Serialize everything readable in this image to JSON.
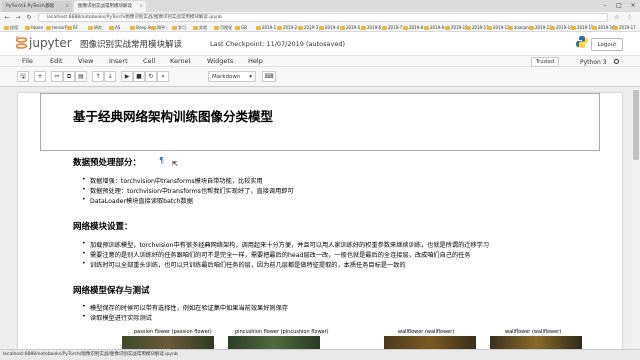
{
  "browser": {
    "tabs": [
      {
        "label": "PyTorch1-PyTorch基础"
      },
      {
        "label": "图像识别实战常用模块解读"
      }
    ],
    "url": "localhost:8888/notebooks/PyTorch/图像识别实战/图像识别实战常用模块解读.ipynb",
    "bookmarks": [
      "应用",
      "hbase",
      "tensorFl",
      "RF",
      "研究",
      "AS",
      "Deep lean",
      "知乎",
      "学习",
      "实验",
      "可视化",
      "GB",
      "2019-1",
      "2019-2",
      "2019-3",
      "2019-4",
      "2019-5",
      "2019-6",
      "2019-7",
      "2019-8",
      "2019-9",
      "2019-10",
      "2019-11",
      "2019-12",
      "anaconda",
      "2019-13",
      "2019-14",
      "2019-15",
      "2019-16",
      "2019-17"
    ]
  },
  "jupyter": {
    "logo_text": "jupyter",
    "notebook_name": "图像识别实战常用模块解读",
    "checkpoint": "Last Checkpoint: 11/07/2019 (autosaved)",
    "logout": "Logout",
    "menu": [
      "File",
      "Edit",
      "View",
      "Insert",
      "Cell",
      "Kernel",
      "Widgets",
      "Help"
    ],
    "trusted": "Trusted",
    "kernel": "Python 3",
    "celltype": "Markdown",
    "toolbar_icons": [
      "save-icon",
      "add-cell-icon",
      "cut-icon",
      "copy-icon",
      "paste-icon",
      "move-up-icon",
      "move-down-icon",
      "run-icon",
      "stop-icon",
      "restart-icon",
      "fast-forward-icon",
      "keyboard-icon"
    ]
  },
  "notebook": {
    "title": "基于经典网络架构训练图像分类模型",
    "pilcrow": "¶",
    "sections": [
      {
        "heading": "数据预处理部分：",
        "items": [
          "数据增强：torchvision中transforms模块自带功能，比较实用",
          "数据预处理：torchvision中transforms也帮我们实现好了，直接调用即可",
          "DataLoader模块直接读取batch数据"
        ]
      },
      {
        "heading": "网络模块设置：",
        "items": [
          "加载预训练模型，torchvision中有很多经典网络架构，调用起来十分方便，并且可以用人家训练好的权重参数来继续训练，也就是所谓的迁移学习",
          "需要注意的是别人训练好的任务跟咱们的可不是完全一样，需要把最后的head层改一改，一般也就是最后的全连接层，改成咱们自己的任务",
          "训练时可以全部重头训练，也可以只训练最后咱们任务的层，因为前几层都是做特征提取的，本质任务目标是一致的"
        ]
      },
      {
        "heading": "网络模型保存与测试",
        "items": [
          "模型保存的时候可以带有选择性，例如在验证集中如果当前效果好则保存",
          "读取模型进行实际测试"
        ]
      }
    ],
    "captions": [
      "passion flower (passion flower)",
      "pincushion flower (pincushion flower)",
      "wallflower (wallflower)",
      "wallflower (wallflower)"
    ]
  },
  "status_bar": "localhost:8888/notebooks/PyTorch/图像识别实战/图像识别实战常用模块解读.ipynb"
}
